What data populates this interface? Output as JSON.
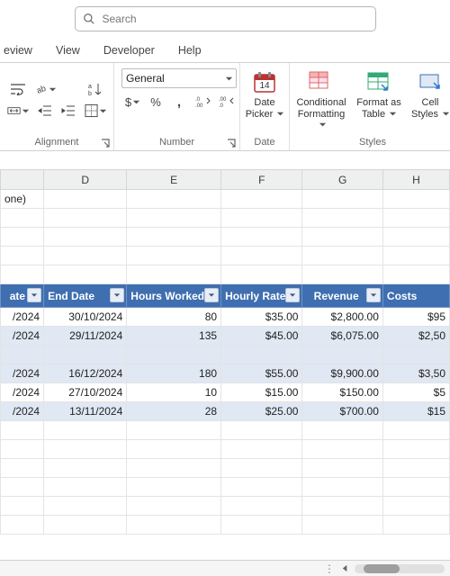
{
  "search": {
    "placeholder": "Search"
  },
  "tabs": {
    "review": "eview",
    "view": "View",
    "developer": "Developer",
    "help": "Help"
  },
  "ribbon": {
    "alignment": {
      "label": "Alignment"
    },
    "number": {
      "label": "Number",
      "format": "General",
      "currency": "$",
      "percent": "%",
      "comma": ",",
      "inc_dec_a": ".0",
      "inc_dec_b": ".00"
    },
    "date": {
      "label": "Date",
      "pickerLabel": "Date Picker",
      "day": "14"
    },
    "styles": {
      "label": "Styles",
      "cond": "Conditional Formatting",
      "fmtTable": "Format as Table",
      "cellStyles": "Cell Styles"
    }
  },
  "columns": {
    "D": "D",
    "E": "E",
    "F": "F",
    "G": "G",
    "H": "H"
  },
  "cellC1": "one)",
  "tableHeaders": {
    "c": "ate",
    "d": "End Date",
    "e": "Hours Worked",
    "f": "Hourly Rate",
    "g": "Revenue",
    "h": "Costs"
  },
  "rows": [
    {
      "c": "/2024",
      "d": "30/10/2024",
      "e": "80",
      "f": "$35.00",
      "g": "$2,800.00",
      "h": "$95"
    },
    {
      "c": "/2024",
      "d": "29/11/2024",
      "e": "135",
      "f": "$45.00",
      "g": "$6,075.00",
      "h": "$2,50"
    },
    {
      "c": "/2024",
      "d": "16/12/2024",
      "e": "180",
      "f": "$55.00",
      "g": "$9,900.00",
      "h": "$3,50"
    },
    {
      "c": "/2024",
      "d": "27/10/2024",
      "e": "10",
      "f": "$15.00",
      "g": "$150.00",
      "h": "$5"
    },
    {
      "c": "/2024",
      "d": "13/11/2024",
      "e": "28",
      "f": "$25.00",
      "g": "$700.00",
      "h": "$15"
    }
  ]
}
